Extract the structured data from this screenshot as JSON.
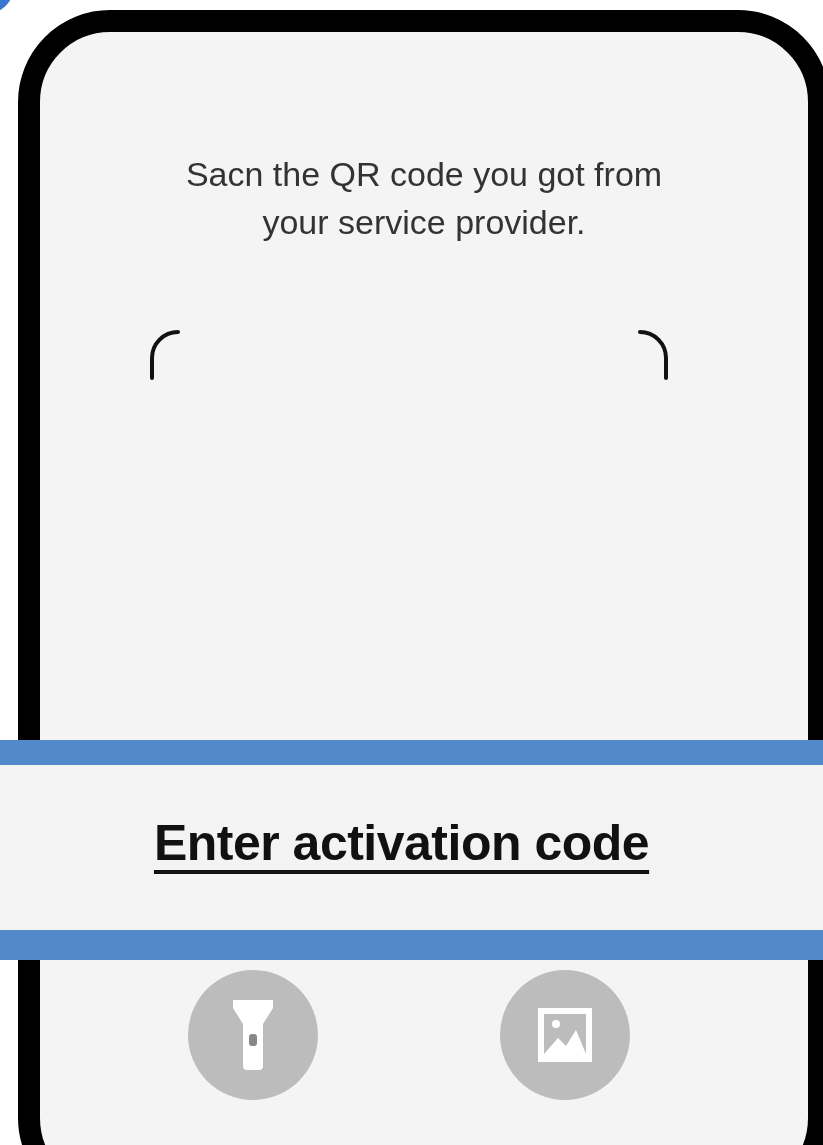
{
  "instruction": "Sacn the QR code you got from\nyour service provider.",
  "activation_link": "Enter activation code",
  "actions": [
    {
      "kind": "flashlight"
    },
    {
      "kind": "gallery"
    }
  ]
}
